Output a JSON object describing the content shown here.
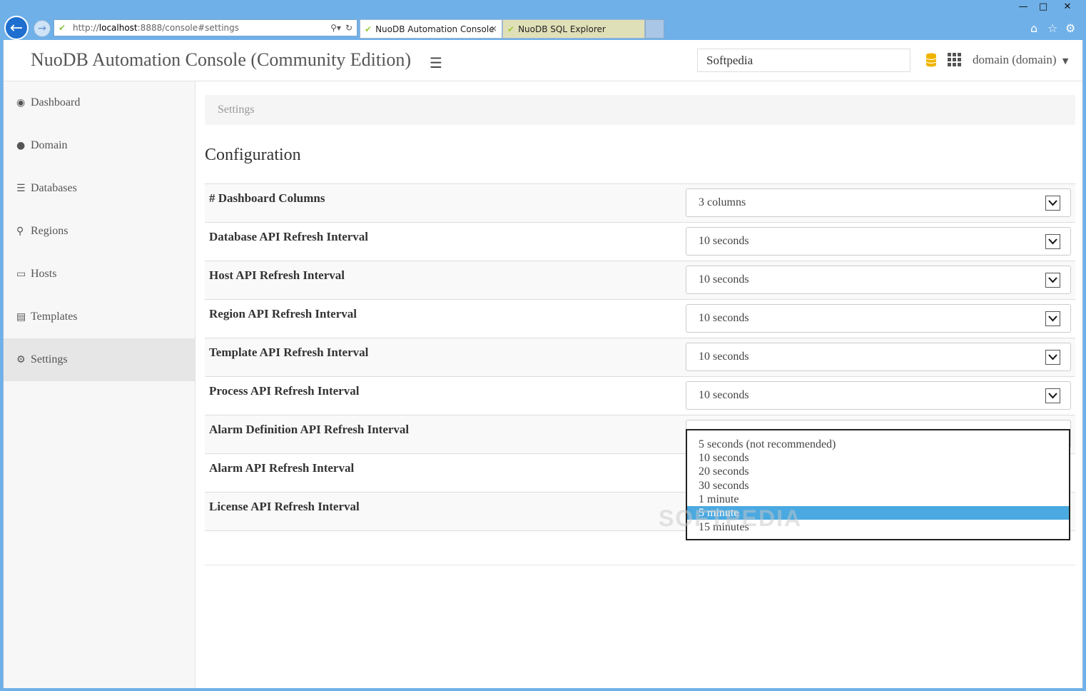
{
  "browser": {
    "url_prefix": "http://",
    "url_host": "localhost",
    "url_rest": ":8888/console#settings",
    "tabs": [
      {
        "title": "NuoDB Automation Console",
        "active": true,
        "close": "×"
      },
      {
        "title": "NuoDB SQL Explorer",
        "active": false
      }
    ],
    "icons": [
      "back-arrow-icon",
      "forward-arrow-icon",
      "search-icon",
      "refresh-icon",
      "home-icon",
      "star-icon",
      "gear-icon"
    ]
  },
  "header": {
    "title": "NuoDB Automation Console (Community Edition)",
    "search_value": "Softpedia",
    "domain_label": "domain (domain)",
    "accent_color": "#f0b400"
  },
  "sidebar": {
    "items": [
      {
        "label": "Dashboard",
        "icon": "dashboard-icon",
        "active": false
      },
      {
        "label": "Domain",
        "icon": "globe-icon",
        "active": false
      },
      {
        "label": "Databases",
        "icon": "database-icon",
        "active": false
      },
      {
        "label": "Regions",
        "icon": "map-marker-icon",
        "active": false
      },
      {
        "label": "Hosts",
        "icon": "monitor-icon",
        "active": false
      },
      {
        "label": "Templates",
        "icon": "document-icon",
        "active": false
      },
      {
        "label": "Settings",
        "icon": "cog-icon",
        "active": true
      }
    ]
  },
  "main": {
    "breadcrumb": "Settings",
    "section_title": "Configuration",
    "rows": [
      {
        "label": "# Dashboard Columns",
        "value": "3 columns"
      },
      {
        "label": "Database API Refresh Interval",
        "value": "10 seconds"
      },
      {
        "label": "Host API Refresh Interval",
        "value": "10 seconds"
      },
      {
        "label": "Region API Refresh Interval",
        "value": "10 seconds"
      },
      {
        "label": "Template API Refresh Interval",
        "value": "10 seconds"
      },
      {
        "label": "Process API Refresh Interval",
        "value": "10 seconds"
      },
      {
        "label": "Alarm Definition API Refresh Interval",
        "value": ""
      },
      {
        "label": "Alarm API Refresh Interval",
        "value": ""
      },
      {
        "label": "License API Refresh Interval",
        "value": ""
      }
    ],
    "dropdown_options": [
      "5 seconds (not recommended)",
      "10 seconds",
      "20 seconds",
      "30 seconds",
      "1 minute",
      "5 minute",
      "15 minutes"
    ],
    "dropdown_selected_index": 5,
    "selection_color": "#4aa9e0"
  },
  "watermark": "SOFTPEDIA"
}
